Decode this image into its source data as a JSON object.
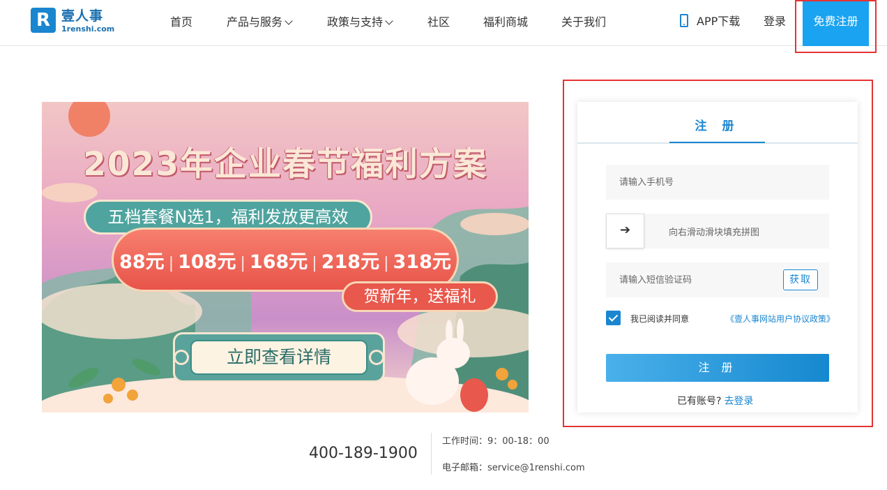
{
  "header": {
    "logo_mark": "R",
    "logo_cn": "壹人事",
    "logo_en": "1renshi.com",
    "nav": [
      {
        "label": "首页",
        "has_dropdown": false
      },
      {
        "label": "产品与服务",
        "has_dropdown": true
      },
      {
        "label": "政策与支持",
        "has_dropdown": true
      },
      {
        "label": "社区",
        "has_dropdown": false
      },
      {
        "label": "福利商城",
        "has_dropdown": false
      },
      {
        "label": "关于我们",
        "has_dropdown": false
      }
    ],
    "app_download": "APP下载",
    "login": "登录",
    "register": "免费注册"
  },
  "banner": {
    "title": "2023年企业春节福利方案",
    "subtitle": "五档套餐N选1，福利发放更高效",
    "prices": [
      "88元",
      "108元",
      "168元",
      "218元",
      "318元"
    ],
    "price_separator": "|",
    "tagline": "贺新年，送福礼",
    "cta": "立即查看详情"
  },
  "register_form": {
    "tab_title": "注 册",
    "phone_placeholder": "请输入手机号",
    "slider_arrow": "➔",
    "slider_hint": "向右滑动滑块填充拼图",
    "sms_placeholder": "请输入短信验证码",
    "get_code": "获取",
    "agree_checked": true,
    "agree_text": "我已阅读并同意",
    "agree_link": "《壹人事网站用户协议政策》",
    "submit": "注 册",
    "have_account": "已有账号?",
    "go_login": "去登录"
  },
  "footer": {
    "hotline": "400-189-1900",
    "work_time": "工作时间：9：00-18：00",
    "email": "电子邮箱：service@1renshi.com"
  },
  "colors": {
    "brand_blue": "#1a86d0",
    "register_blue": "#19a3f0",
    "highlight_red": "#e53333"
  }
}
